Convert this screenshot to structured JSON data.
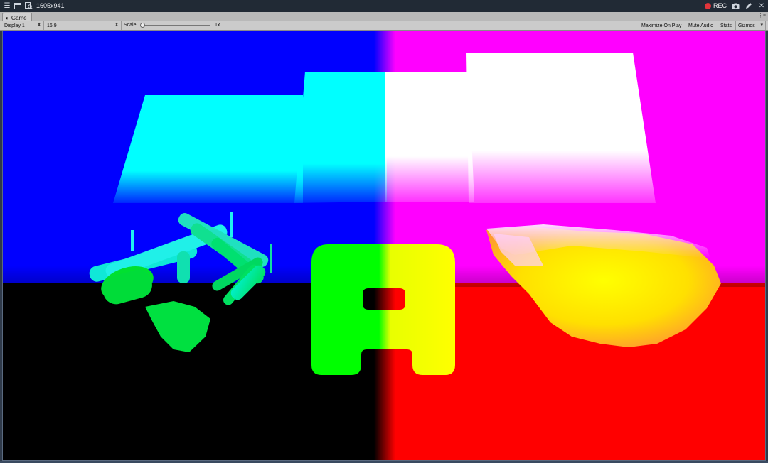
{
  "titlebar": {
    "menu_icon": "hamburger-icon",
    "resolution_label": "1605x941",
    "rec_label": "REC"
  },
  "tab": {
    "label": "Game",
    "icon": "game-controller-icon"
  },
  "toolbar": {
    "display_label": "Display 1",
    "aspect_label": "16:9",
    "scale_label": "Scale",
    "scale_value": "1x",
    "maximize_label": "Maximize On Play",
    "mute_label": "Mute Audio",
    "stats_label": "Stats",
    "gizmos_label": "Gizmos"
  },
  "colors": {
    "quadrant_top_left": "#0000ff",
    "quadrant_top_right": "#ff00ff",
    "quadrant_bottom_left": "#000000",
    "quadrant_bottom_right": "#ff0000",
    "rec_dot": "#e0343a"
  }
}
